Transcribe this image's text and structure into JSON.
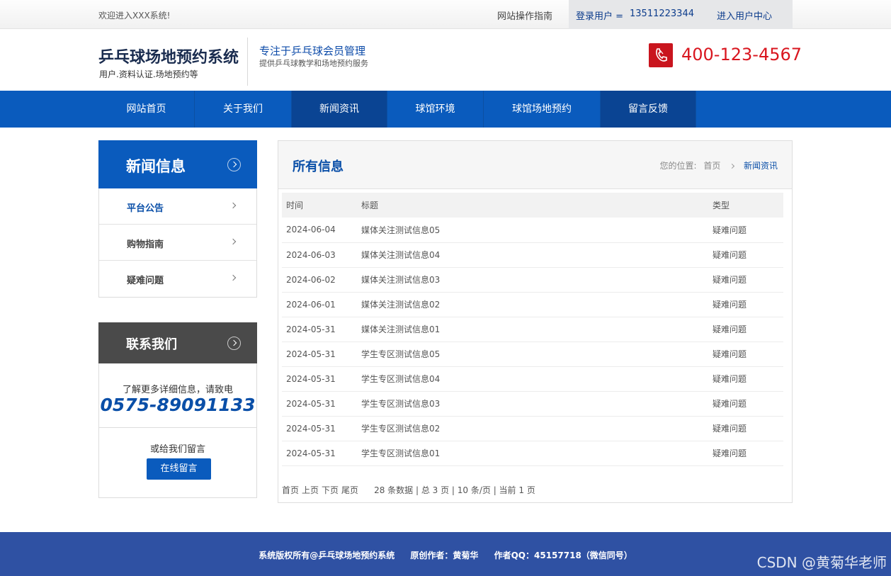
{
  "topbar": {
    "welcome": "欢迎进入XXX系统!",
    "guide": "网站操作指南",
    "user_label": "登录用户 =",
    "user_phone": "13511223344",
    "user_center": "进入用户中心"
  },
  "header": {
    "site_name": "乒乓球场地预约系统",
    "site_sub": "用户.资料认证.场地预约等",
    "slogan": "专注于乒乓球会员管理",
    "slogan_sub": "提供乒乓球教学和场地预约服务",
    "phone_icon": "phone-icon",
    "hotline": "400-123-4567"
  },
  "nav": {
    "items": [
      {
        "label": "网站首页",
        "active": false
      },
      {
        "label": "关于我们",
        "active": false
      },
      {
        "label": "新闻资讯",
        "active": true
      },
      {
        "label": "球馆环境",
        "active": false
      },
      {
        "label": "球馆场地预约",
        "active": false
      },
      {
        "label": "留言反馈",
        "active": true
      }
    ]
  },
  "sidebar": {
    "news_title": "新闻信息",
    "items": [
      {
        "label": "平台公告",
        "active": true
      },
      {
        "label": "购物指南",
        "active": false
      },
      {
        "label": "疑难问题",
        "active": false
      }
    ],
    "contact_title": "联系我们",
    "contact_text": "了解更多详细信息，请致电",
    "contact_phone": "0575-89091133",
    "message_text": "或给我们留言",
    "message_button": "在线留言"
  },
  "main": {
    "title": "所有信息",
    "breadcrumb_label": "您的位置:",
    "breadcrumb_home": "首页",
    "breadcrumb_current": "新闻资讯",
    "columns": [
      "时间",
      "标题",
      "类型"
    ],
    "rows": [
      {
        "date": "2024-06-04",
        "title": "媒体关注测试信息05",
        "type": "疑难问题"
      },
      {
        "date": "2024-06-03",
        "title": "媒体关注测试信息04",
        "type": "疑难问题"
      },
      {
        "date": "2024-06-02",
        "title": "媒体关注测试信息03",
        "type": "疑难问题"
      },
      {
        "date": "2024-06-01",
        "title": "媒体关注测试信息02",
        "type": "疑难问题"
      },
      {
        "date": "2024-05-31",
        "title": "媒体关注测试信息01",
        "type": "疑难问题"
      },
      {
        "date": "2024-05-31",
        "title": "学生专区测试信息05",
        "type": "疑难问题"
      },
      {
        "date": "2024-05-31",
        "title": "学生专区测试信息04",
        "type": "疑难问题"
      },
      {
        "date": "2024-05-31",
        "title": "学生专区测试信息03",
        "type": "疑难问题"
      },
      {
        "date": "2024-05-31",
        "title": "学生专区测试信息02",
        "type": "疑难问题"
      },
      {
        "date": "2024-05-31",
        "title": "学生专区测试信息01",
        "type": "疑难问题"
      }
    ],
    "pager": {
      "first": "首页",
      "prev": "上页",
      "next": "下页",
      "last": "尾页",
      "info": "28 条数据 | 总 3 页 | 10 条/页 | 当前 1 页"
    }
  },
  "footer": {
    "copyright": "系统版权所有@乒乓球场地预约系统",
    "author": "原创作者：黄菊华",
    "qq": "作者QQ：45157718（微信同号）"
  },
  "watermark": "CSDN @黄菊华老师",
  "colors": {
    "nav_blue": "#0a5bbd",
    "nav_active": "#0a4493",
    "hotline_red": "#d9161f",
    "footer_blue": "#2f51a3"
  }
}
